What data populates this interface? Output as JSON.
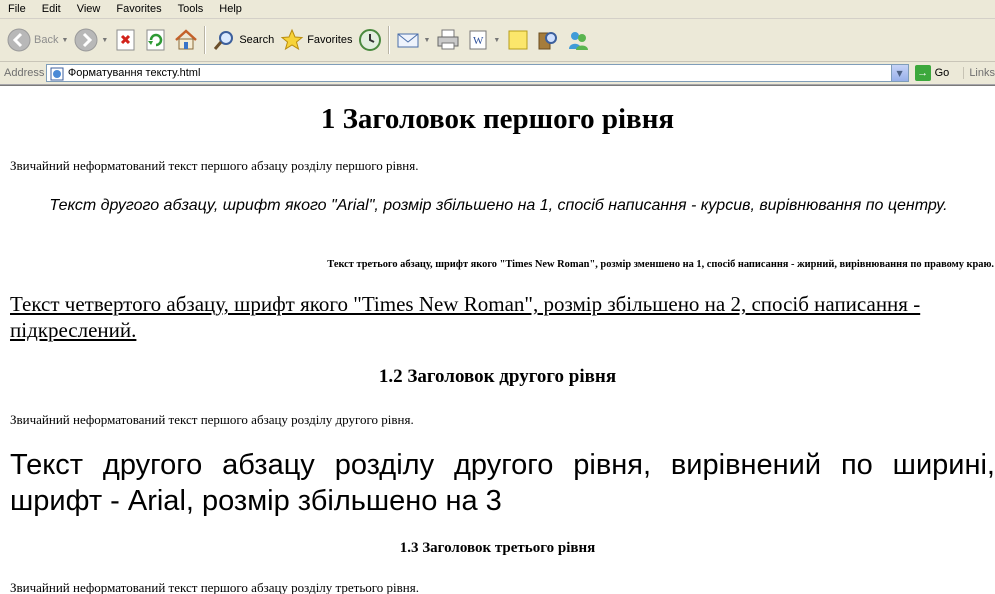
{
  "menu": [
    "File",
    "Edit",
    "View",
    "Favorites",
    "Tools",
    "Help"
  ],
  "toolbar": {
    "back_label": "Back",
    "search_label": "Search",
    "favorites_label": "Favorites"
  },
  "address": {
    "label": "Address",
    "url": "Форматування тексту.html",
    "go_label": "Go",
    "links_label": "Links"
  },
  "page": {
    "h1": "1 Заголовок першого рівня",
    "p1": "Звичайний неформатований текст першого абзацу розділу першого рівня.",
    "p2": "Текст другого абзацу, шрифт якого \"Arial\", розмір збільшено на 1, спосіб написання - курсив, вирівнювання по центру.",
    "p3": "Текст третього абзацу, шрифт якого \"Times New Roman\", розмір зменшено на 1, спосіб написання - жирний, вирівнювання по правому краю.",
    "p4": "Текст четвертого абзацу, шрифт якого \"Times New Roman\", розмір збільшено на 2, спосіб написання - підкреслений.",
    "h2": "1.2 Заголовок другого рівня",
    "p5": "Звичайний неформатований текст першого абзацу розділу другого рівня.",
    "p6": "Текст другого абзацу розділу другого рівня, вирівнений по ширині, шрифт - Arial, розмір збільшено на 3",
    "h3": "1.3 Заголовок третього рівня",
    "p7": "Звичайний неформатований текст першого абзацу розділу третього рівня."
  }
}
